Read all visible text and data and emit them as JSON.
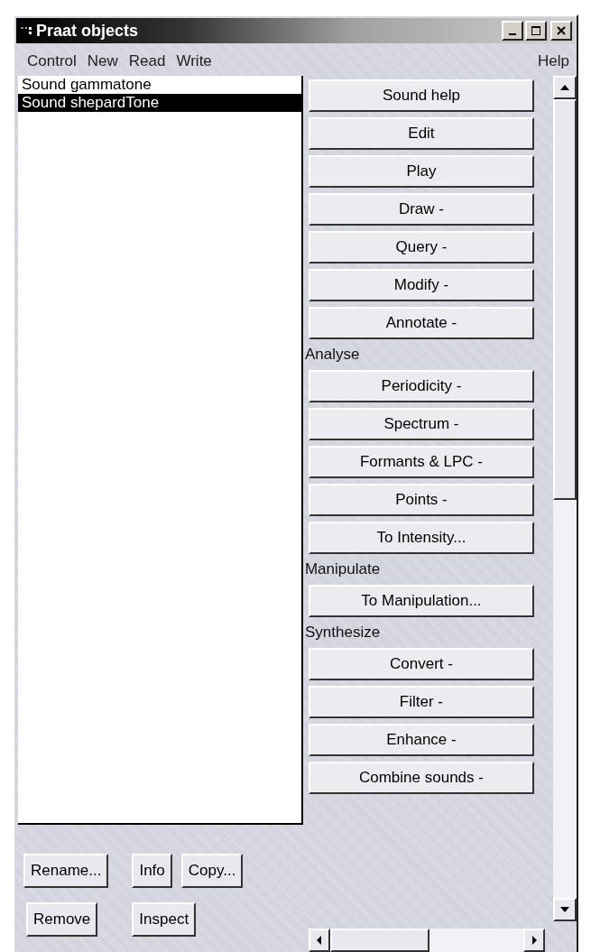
{
  "window": {
    "title": "Praat objects"
  },
  "menu": {
    "left": [
      "Control",
      "New",
      "Read",
      "Write"
    ],
    "right": [
      "Help"
    ]
  },
  "objects": [
    {
      "label": "Sound gammatone",
      "selected": false
    },
    {
      "label": "Sound shepardTone",
      "selected": true
    }
  ],
  "actions": [
    {
      "kind": "button",
      "label": "Sound help"
    },
    {
      "kind": "button",
      "label": "Edit"
    },
    {
      "kind": "button",
      "label": "Play"
    },
    {
      "kind": "button",
      "label": "Draw -"
    },
    {
      "kind": "button",
      "label": "Query -"
    },
    {
      "kind": "button",
      "label": "Modify -"
    },
    {
      "kind": "button",
      "label": "Annotate -"
    },
    {
      "kind": "heading",
      "label": "Analyse"
    },
    {
      "kind": "button",
      "label": "Periodicity -"
    },
    {
      "kind": "button",
      "label": "Spectrum -"
    },
    {
      "kind": "button",
      "label": "Formants & LPC -"
    },
    {
      "kind": "button",
      "label": "Points -"
    },
    {
      "kind": "button",
      "label": "To Intensity..."
    },
    {
      "kind": "heading",
      "label": "Manipulate"
    },
    {
      "kind": "button",
      "label": "To Manipulation..."
    },
    {
      "kind": "heading",
      "label": "Synthesize"
    },
    {
      "kind": "button",
      "label": "Convert -"
    },
    {
      "kind": "button",
      "label": "Filter -"
    },
    {
      "kind": "button",
      "label": "Enhance -"
    },
    {
      "kind": "button",
      "label": "Combine sounds -"
    }
  ],
  "bottom_buttons": [
    [
      "Rename...",
      "Info",
      "Copy..."
    ],
    [
      "Remove",
      "Inspect"
    ]
  ]
}
